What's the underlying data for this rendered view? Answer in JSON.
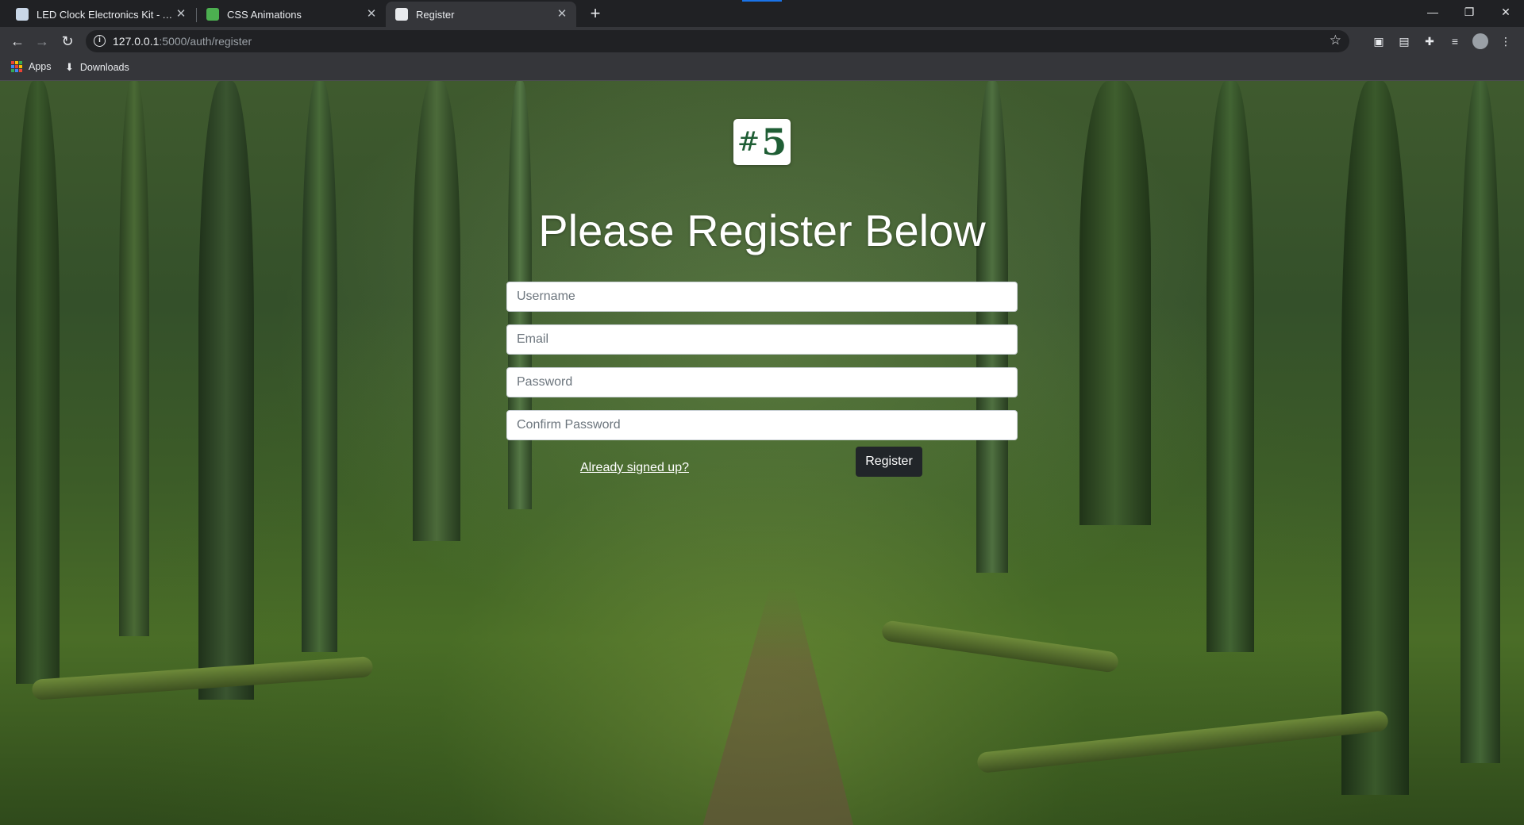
{
  "browser": {
    "tabs": [
      {
        "label": "LED Clock Electronics Kit - Alarm",
        "favicon": "led-clock-favicon",
        "active": false
      },
      {
        "label": "CSS Animations",
        "favicon": "css-animations-favicon",
        "active": false
      },
      {
        "label": "Register",
        "favicon": "register-favicon",
        "active": true
      }
    ],
    "url_host": "127.0.0.1",
    "url_path": ":5000/auth/register",
    "bookmarks": [
      {
        "label": "Apps",
        "icon": "apps-grid-icon"
      },
      {
        "label": "Downloads",
        "icon": "download-icon"
      }
    ]
  },
  "page": {
    "logo_hash": "#",
    "logo_number": "5",
    "heading": "Please Register Below",
    "form": {
      "username_placeholder": "Username",
      "email_placeholder": "Email",
      "password_placeholder": "Password",
      "confirm_password_placeholder": "Confirm Password",
      "login_link": "Already signed up?",
      "submit_label": "Register"
    }
  },
  "colors": {
    "chrome_bg": "#202124",
    "toolbar_bg": "#35363a",
    "logo_green": "#1f5e35",
    "button_dark": "#212529"
  }
}
